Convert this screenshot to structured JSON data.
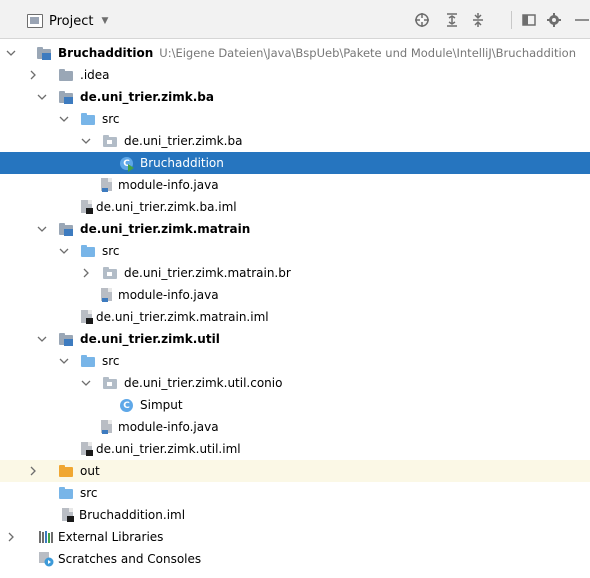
{
  "toolbar": {
    "title": "Project",
    "icons": [
      "locate-target-icon",
      "expand-all-icon",
      "collapse-all-icon",
      "layout-window-icon",
      "gear-icon",
      "hide-minus-icon"
    ]
  },
  "tree": {
    "rows": [
      {
        "label": "Bruchaddition",
        "path": "U:\\Eigene Dateien\\Java\\BspUeb\\Pakete und Module\\IntelliJ\\Bruchaddition",
        "icon": "module-folder-icon",
        "bold": true
      },
      {
        "label": ".idea",
        "icon": "folder-icon"
      },
      {
        "label": "de.uni_trier.zimk.ba",
        "icon": "module-folder-icon",
        "bold": true
      },
      {
        "label": "src",
        "icon": "source-folder-icon"
      },
      {
        "label": "de.uni_trier.zimk.ba",
        "icon": "package-icon"
      },
      {
        "label": "Bruchaddition",
        "icon": "runnable-class-icon",
        "selected": true
      },
      {
        "label": "module-info.java",
        "icon": "module-info-file-icon"
      },
      {
        "label": "de.uni_trier.zimk.ba.iml",
        "icon": "iml-file-icon"
      },
      {
        "label": "de.uni_trier.zimk.matrain",
        "icon": "module-folder-icon",
        "bold": true
      },
      {
        "label": "src",
        "icon": "source-folder-icon"
      },
      {
        "label": "de.uni_trier.zimk.matrain.br",
        "icon": "package-icon"
      },
      {
        "label": "module-info.java",
        "icon": "module-info-file-icon"
      },
      {
        "label": "de.uni_trier.zimk.matrain.iml",
        "icon": "iml-file-icon"
      },
      {
        "label": "de.uni_trier.zimk.util",
        "icon": "module-folder-icon",
        "bold": true
      },
      {
        "label": "src",
        "icon": "source-folder-icon"
      },
      {
        "label": "de.uni_trier.zimk.util.conio",
        "icon": "package-icon"
      },
      {
        "label": "Simput",
        "icon": "class-icon"
      },
      {
        "label": "module-info.java",
        "icon": "module-info-file-icon"
      },
      {
        "label": "de.uni_trier.zimk.util.iml",
        "icon": "iml-file-icon"
      },
      {
        "label": "out",
        "icon": "excluded-folder-icon"
      },
      {
        "label": "src",
        "icon": "source-folder-icon"
      },
      {
        "label": "Bruchaddition.iml",
        "icon": "iml-file-icon"
      },
      {
        "label": "External Libraries",
        "icon": "libraries-icon"
      },
      {
        "label": "Scratches and Consoles",
        "icon": "scratches-icon"
      }
    ]
  },
  "colors": {
    "selection": "#2675bf",
    "excluded_row": "#fbf8e6",
    "folder": "#9aa7b6",
    "source_folder": "#78b5e8",
    "excluded_folder": "#f0a732",
    "class_icon": "#5fa8e8"
  }
}
